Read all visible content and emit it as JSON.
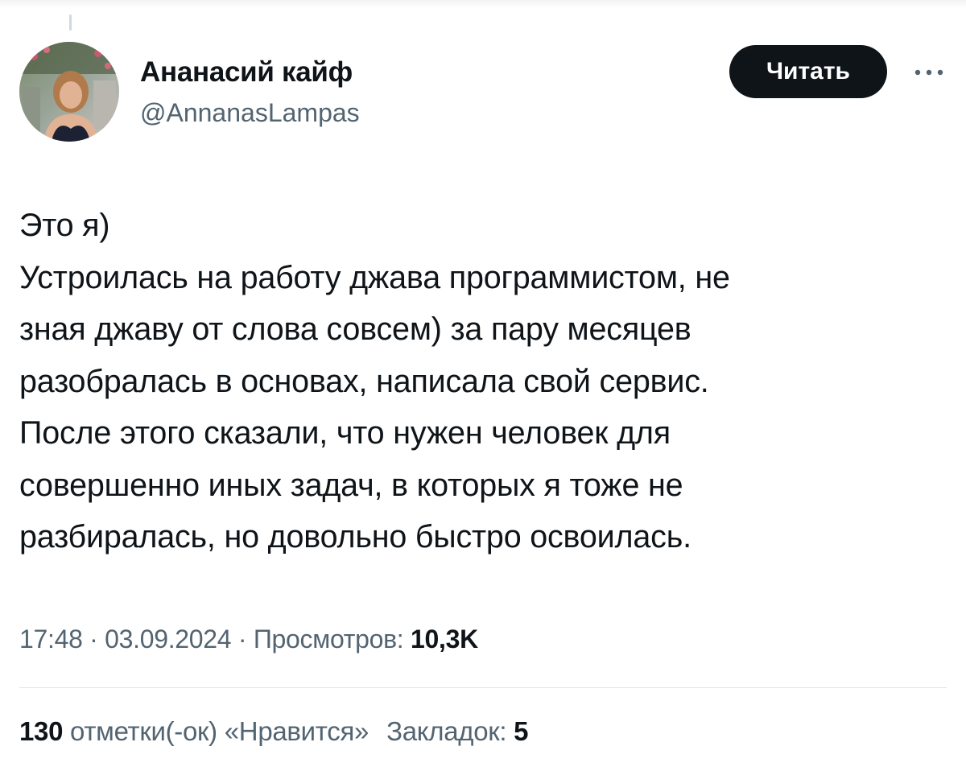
{
  "author": {
    "display_name": "Ананасий кайф",
    "handle": "@AnnanasLampas"
  },
  "actions": {
    "follow_label": "Читать",
    "more_icon": "more-horizontal-icon"
  },
  "tweet": {
    "lines": [
      "Это я)",
      "Устроилась на работу джава программистом, не",
      "зная джаву от слова совсем) за пару месяцев",
      "разобралась в основах, написала свой сервис.",
      "После этого сказали, что нужен человек для",
      "совершенно иных задач, в которых я тоже не",
      "разбиралась, но довольно быстро освоилась."
    ]
  },
  "meta": {
    "time": "17:48",
    "separator": " · ",
    "date": "03.09.2024",
    "views_label": "Просмотров: ",
    "views_count": "10,3K"
  },
  "stats": {
    "likes_count": "130",
    "likes_label": " отметки(-ок) «Нравится»",
    "bookmarks_label": "Закладок: ",
    "bookmarks_count": "5"
  },
  "colors": {
    "text_primary": "#0f1419",
    "text_secondary": "#536471",
    "button_bg": "#0f1419",
    "divider": "#e1e6ea"
  }
}
